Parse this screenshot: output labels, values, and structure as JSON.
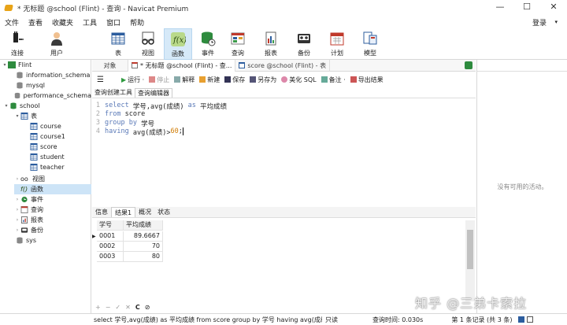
{
  "window": {
    "title": "* 无标题 @school (Flint) - 查询 - Navicat Premium",
    "min": "—",
    "max": "☐",
    "close": "✕"
  },
  "menu": {
    "items": [
      "文件",
      "查看",
      "收藏夹",
      "工具",
      "窗口",
      "帮助"
    ],
    "login": "登录"
  },
  "toolbar": {
    "connect": "连接",
    "user": "用户",
    "table": "表",
    "view": "视图",
    "function": "函数",
    "event": "事件",
    "query": "查询",
    "report": "报表",
    "backup": "备份",
    "schedule": "计划",
    "model": "模型"
  },
  "tree": {
    "flint": "Flint",
    "information_schema": "information_schema",
    "mysql": "mysql",
    "performance_schema": "performance_schema",
    "school": "school",
    "tables": "表",
    "course": "course",
    "course1": "course1",
    "score": "score",
    "student": "student",
    "teacher": "teacher",
    "views": "视图",
    "functions": "函数",
    "events": "事件",
    "queries": "查询",
    "reports": "报表",
    "backups": "备份",
    "sys": "sys"
  },
  "tabs": {
    "objects": "对象",
    "query_tab": "* 无标题 @school (Flint) - 查...",
    "score_tab": "score @school (Flint) - 表"
  },
  "query_toolbar": {
    "run": "运行 ·",
    "stop": "停止",
    "explain": "解释",
    "new": "新建",
    "save": "保存",
    "save_as": "另存为",
    "beautify": "美化 SQL",
    "note": "备注 ·",
    "export": "导出结果"
  },
  "subtabs": {
    "builder": "查询创建工具",
    "editor": "查询编辑器"
  },
  "sql": {
    "l1_kw1": "select",
    "l1_mid": " 学号,avg(成绩) ",
    "l1_kw2": "as",
    "l1_end": " 平均成绩",
    "l2_kw": "from",
    "l2_rest": " score",
    "l3_kw": "group by",
    "l3_rest": " 学号",
    "l4_kw": "having",
    "l4_rest": " avg(成绩)>",
    "l4_num": "60",
    "l4_semi": ";"
  },
  "result_tabs": {
    "info": "信息",
    "result1": "结果1",
    "profile": "概况",
    "status": "状态"
  },
  "grid": {
    "columns": [
      "学号",
      "平均成绩"
    ],
    "rows": [
      [
        "0001",
        "89.6667"
      ],
      [
        "0002",
        "70"
      ],
      [
        "0003",
        "80"
      ]
    ]
  },
  "grid_footer": [
    "+",
    "−",
    "✓",
    "✕",
    "C",
    "⊘"
  ],
  "right_pane": {
    "message": "没有可用的活动。"
  },
  "status": {
    "sql": "select 学号,avg(成绩) as 平均成绩 from score group by 学号 having avg(成绩",
    "readonly": "只读",
    "time": "查询时间: 0.030s",
    "records": "第 1 条记录 (共 3 条)"
  },
  "watermark": "知乎 @三弟卡索拉"
}
